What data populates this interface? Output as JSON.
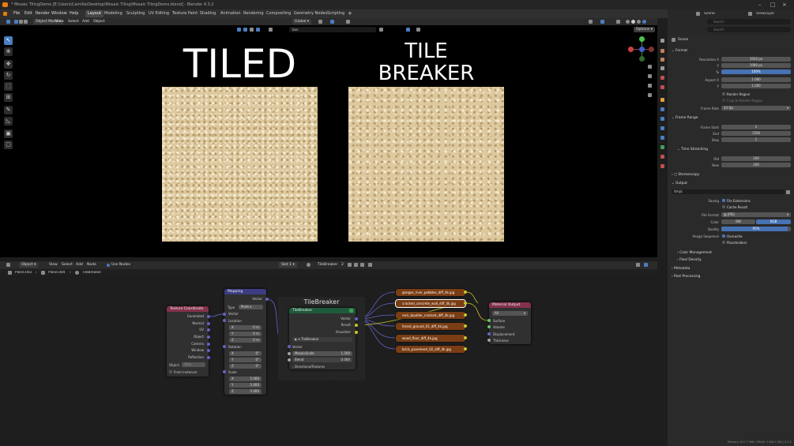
{
  "app": {
    "title": "* Mosaic TilingDemo [E:\\Users\\Camille\\Desktop\\Mosaic Tiling\\Mosaic TilingDemo.blend] - Blender 4.3.2"
  },
  "menu": [
    "File",
    "Edit",
    "Render",
    "Window",
    "Help"
  ],
  "workspaces": [
    "Layout",
    "Modeling",
    "Sculpting",
    "UV Editing",
    "Texture Paint",
    "Shading",
    "Animation",
    "Rendering",
    "Compositing",
    "Geometry Nodes",
    "Scripting"
  ],
  "active_workspace": "Layout",
  "viewport_header": {
    "mode": "Object Mode",
    "menus": [
      "View",
      "Select",
      "Add",
      "Object"
    ],
    "orientation": "Global",
    "search": "ban",
    "options": "Options"
  },
  "viewport": {
    "left_title": "TILED",
    "right_title_line1": "TILE",
    "right_title_line2": "BREAKER"
  },
  "node_header": {
    "editor": "Object",
    "menus": [
      "View",
      "Select",
      "Add",
      "Node"
    ],
    "use_nodes": "Use Nodes",
    "slot": "Slot 1",
    "material": "TileBreaker",
    "users": "2"
  },
  "breadcrumb": {
    "obj1": "Plane.002",
    "obj2": "Plane.004",
    "material": "TileBreaker"
  },
  "nodes": {
    "texcoord": {
      "title": "Texture Coordinate",
      "outputs": [
        "Generated",
        "Normal",
        "UV",
        "Object",
        "Camera",
        "Window",
        "Reflection"
      ],
      "object_label": "Object",
      "object_value": "Obje",
      "from_instancer": "From Instancer"
    },
    "mapping": {
      "title": "Mapping",
      "out": "Vector",
      "type_label": "Type",
      "type_value": "Point",
      "vector": "Vector",
      "location": "Location",
      "rotation": "Rotation",
      "scale": "Scale",
      "axes": [
        "X",
        "Y",
        "Z"
      ],
      "loc": [
        "0 m",
        "0 m",
        "0 m"
      ],
      "rot": [
        "0°",
        "0°",
        "0°"
      ],
      "scl": [
        "5.000",
        "5.000",
        "5.000"
      ]
    },
    "group_label": "TileBreaker",
    "tilebreaker": {
      "title": "TileBreaker",
      "outputs": [
        "Vector",
        "Result",
        "Visualizer"
      ],
      "group_name": "TileBreaker",
      "inputs": [
        "Vector",
        "MosaicScale",
        "Blend"
      ],
      "mosaic": "1.500",
      "blend": "0.000",
      "directional": "DirectionalTextures"
    },
    "images": [
      "ganges_river_pebbles_diff_4k.jpg",
      "cracked_concrete_wall_diff_4k.jpg",
      "rock_boulder_cracked_diff_4k.jpg",
      "forest_ground_01_diff_4k.jpg",
      "wood_floor_diff_4k.jpg",
      "brick_pavement_02_diff_4k.jpg"
    ],
    "output": {
      "title": "Material Output",
      "target": "All",
      "inputs": [
        "Surface",
        "Volume",
        "Displacement",
        "Thickness"
      ]
    }
  },
  "outliner": {
    "scene": "Scene",
    "viewlayer": "ViewLayer",
    "search": "Search",
    "search2": "Search"
  },
  "props": {
    "scene_label": "Scene",
    "format": "Format",
    "res_x_label": "Resolution X",
    "res_x": "1920 px",
    "res_y_label": "Y",
    "res_y": "1080 px",
    "pct_label": "%",
    "pct": "100%",
    "aspect_x_label": "Aspect X",
    "aspect_x": "1.000",
    "aspect_y_label": "Y",
    "aspect_y": "1.000",
    "render_region": "Render Region",
    "crop": "Crop to Render Region",
    "framerate_label": "Frame Rate",
    "framerate": "24 fps",
    "frame_range": "Frame Range",
    "start_label": "Frame Start",
    "start": "1",
    "end_label": "End",
    "end": "1500",
    "step_label": "Step",
    "step": "1",
    "time_stretching": "Time Stretching",
    "old_label": "Old",
    "old": "100",
    "new_label": "New",
    "new": "100",
    "stereoscopy": "Stereoscopy",
    "output": "Output",
    "path": "/tmp\\",
    "saving_label": "Saving",
    "file_ext": "File Extensions",
    "cache": "Cache Result",
    "fileformat_label": "File Format",
    "fileformat": "JPEG",
    "color_label": "Color",
    "bw": "BW",
    "rgb": "RGB",
    "quality_label": "Quality",
    "quality": "95%",
    "imgseq_label": "Image Sequence",
    "overwrite": "Overwrite",
    "placeholders": "Placeholders",
    "color_mgmt": "Color Management",
    "pixel_density": "Pixel Density",
    "metadata": "Metadata",
    "post": "Post Processing"
  },
  "status": "Memory: 812.7 MiB | VRAM: 1.8/8.0 GiB | 4.3.2",
  "chart_fill": {
    "quality": 0.95
  }
}
